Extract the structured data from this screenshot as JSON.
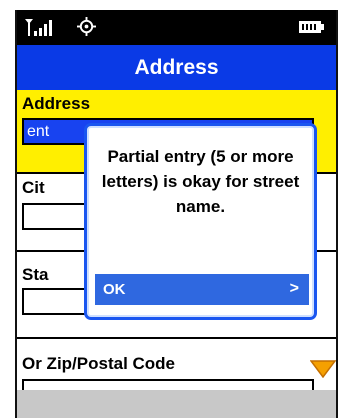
{
  "screen": {
    "title": "Address"
  },
  "form": {
    "address_label": "Address",
    "address_value": "ent",
    "city_label": "Cit",
    "state_label": "Sta",
    "zip_label": "Or Zip/Postal Code"
  },
  "dialog": {
    "message": "Partial entry (5 or more letters) is okay for street name.",
    "ok_label": "OK",
    "ok_chevron": ">"
  },
  "colors": {
    "title_bar": "#0a3ae6",
    "address_section": "#ffef00",
    "dialog_border": "#1a56f0",
    "ok_button": "#2f68e0",
    "scroll_arrow": "#f5a000"
  }
}
